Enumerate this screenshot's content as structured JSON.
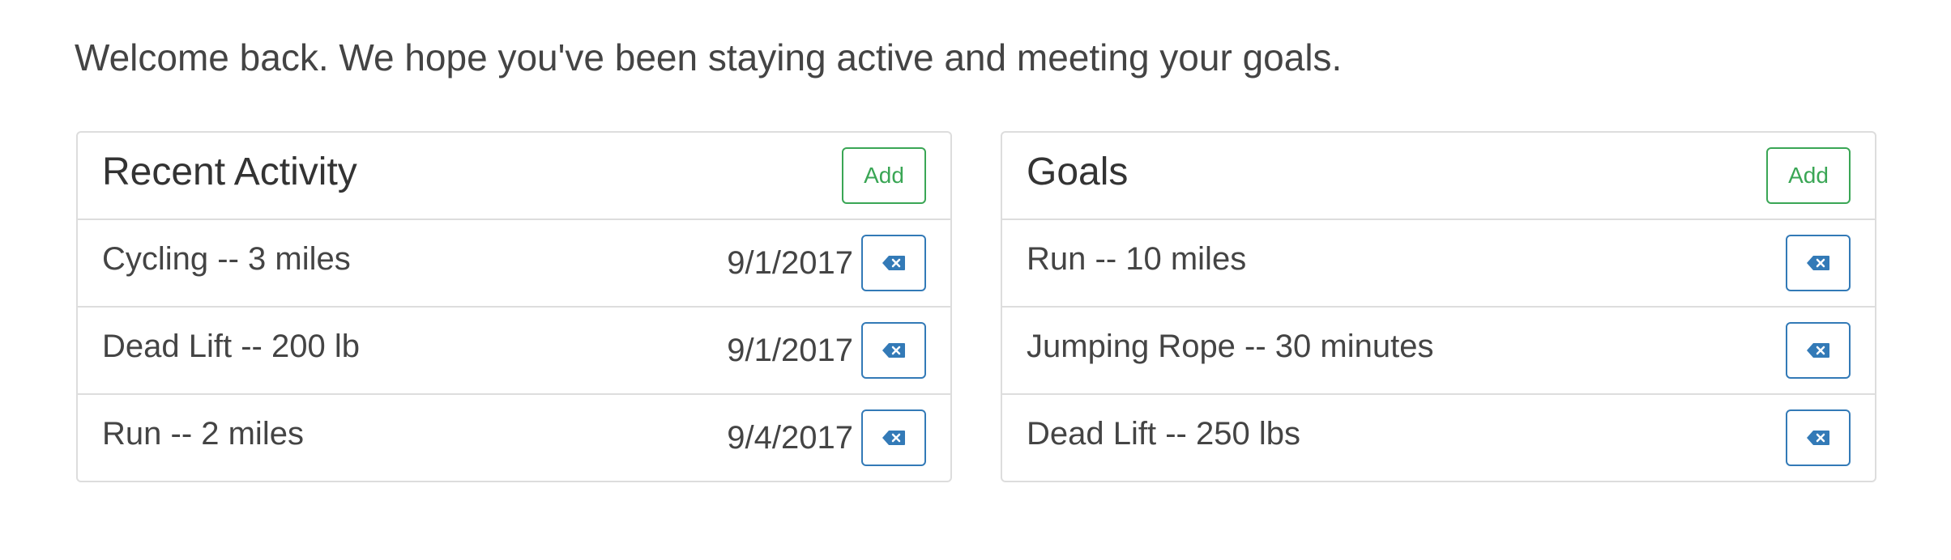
{
  "welcome_message": "Welcome back. We hope you've been staying active and meeting your goals.",
  "colors": {
    "add_accent": "#3aa655",
    "delete_accent": "#337ab7",
    "border": "#dddddd"
  },
  "recent_activity": {
    "title": "Recent Activity",
    "add_label": "Add",
    "items": [
      {
        "label": "Cycling -- 3 miles",
        "date": "9/1/2017",
        "delete_icon": "backspace-icon"
      },
      {
        "label": "Dead Lift -- 200 lb",
        "date": "9/1/2017",
        "delete_icon": "backspace-icon"
      },
      {
        "label": "Run -- 2 miles",
        "date": "9/4/2017",
        "delete_icon": "backspace-icon"
      }
    ]
  },
  "goals": {
    "title": "Goals",
    "add_label": "Add",
    "items": [
      {
        "label": "Run -- 10 miles",
        "delete_icon": "backspace-icon"
      },
      {
        "label": "Jumping Rope -- 30 minutes",
        "delete_icon": "backspace-icon"
      },
      {
        "label": "Dead Lift -- 250 lbs",
        "delete_icon": "backspace-icon"
      }
    ]
  }
}
